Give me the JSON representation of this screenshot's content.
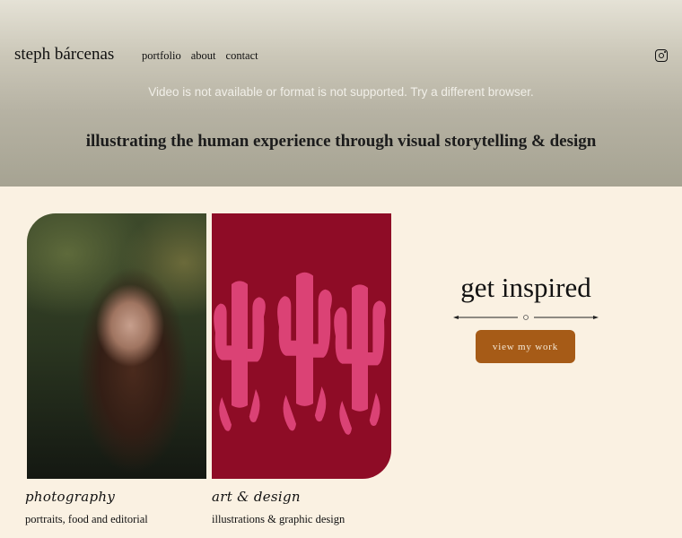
{
  "header": {
    "brand": "steph bárcenas",
    "nav": [
      "portfolio",
      "about",
      "contact"
    ],
    "video_message": "Video is not available or format is not supported. Try a different browser.",
    "tagline": "illustrating the human experience through visual storytelling & design"
  },
  "cards": [
    {
      "title": "photography",
      "subtitle": "portraits, food and editorial"
    },
    {
      "title": "art & design",
      "subtitle": "illustrations & graphic design"
    }
  ],
  "promo": {
    "heading": "get inspired",
    "button_label": "view my work"
  },
  "colors": {
    "page_background": "#faf1e2",
    "button": "#a65b17",
    "art_background": "#8e0c26",
    "cactus": "#e0457a"
  }
}
